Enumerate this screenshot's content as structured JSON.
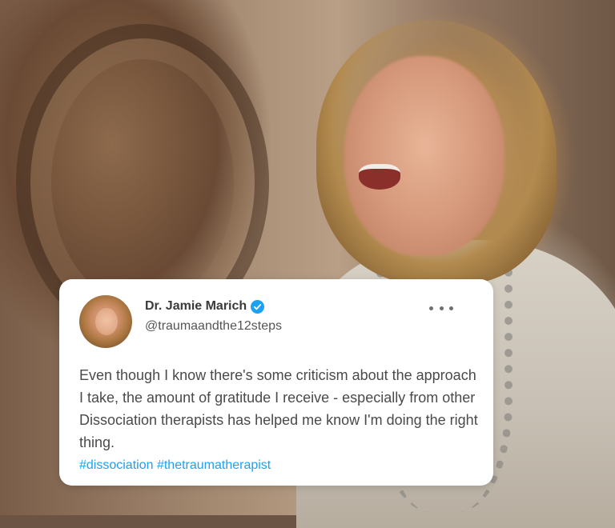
{
  "tweet": {
    "display_name": "Dr. Jamie Marich",
    "handle": "@traumaandthe12steps",
    "verified": true,
    "text": "Even though I know there's some criticism about the approach I take, the amount of gratitude I receive - especially from other Dissociation therapists has helped me know I'm doing the right thing.",
    "hashtags": "#dissociation #thetraumatherapist",
    "more_icon": "more-horizontal-icon",
    "verified_icon": "verified-badge-icon"
  },
  "colors": {
    "card_background": "#ffffff",
    "accent_blue": "#1da1f2",
    "text": "#4a4a4a"
  }
}
